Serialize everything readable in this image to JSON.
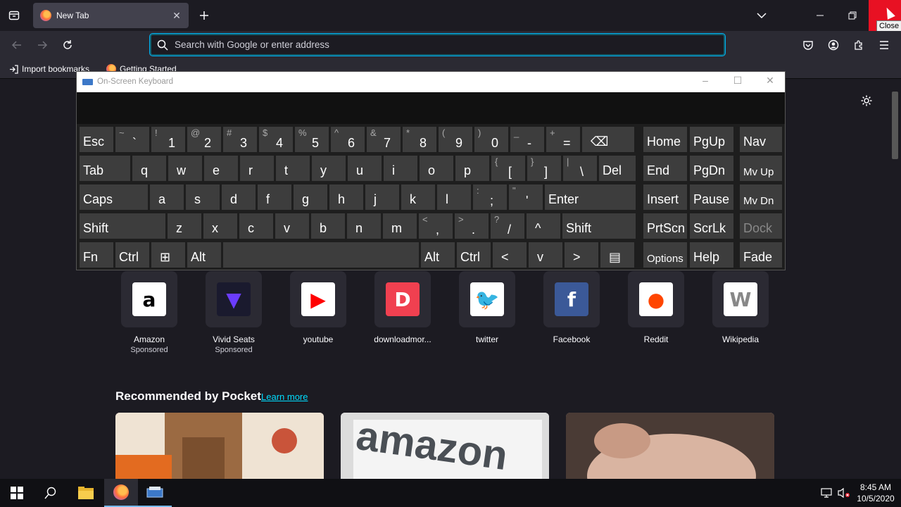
{
  "browser": {
    "tab_title": "New Tab",
    "url_placeholder": "Search with Google or enter address",
    "tooltip_close": "Close",
    "bookmarks": [
      "Import bookmarks",
      "Getting Started"
    ]
  },
  "osk": {
    "title": "On-Screen Keyboard",
    "rows": [
      [
        {
          "m": "Esc",
          "w": 48
        },
        {
          "s": "~",
          "m": "`",
          "w": 48
        },
        {
          "s": "!",
          "m": "1",
          "w": 48
        },
        {
          "s": "@",
          "m": "2",
          "w": 48
        },
        {
          "s": "#",
          "m": "3",
          "w": 48
        },
        {
          "s": "$",
          "m": "4",
          "w": 48
        },
        {
          "s": "%",
          "m": "5",
          "w": 48
        },
        {
          "s": "^",
          "m": "6",
          "w": 48
        },
        {
          "s": "&",
          "m": "7",
          "w": 48
        },
        {
          "s": "*",
          "m": "8",
          "w": 48
        },
        {
          "s": "(",
          "m": "9",
          "w": 48
        },
        {
          "s": ")",
          "m": "0",
          "w": 48
        },
        {
          "s": "_",
          "m": "-",
          "w": 48
        },
        {
          "s": "+",
          "m": "=",
          "w": 48
        },
        {
          "m": "⌫",
          "w": 74
        }
      ],
      [
        {
          "m": "Tab",
          "w": 72
        },
        {
          "m": "q",
          "w": 48
        },
        {
          "m": "w",
          "w": 48
        },
        {
          "m": "e",
          "w": 48
        },
        {
          "m": "r",
          "w": 48
        },
        {
          "m": "t",
          "w": 48
        },
        {
          "m": "y",
          "w": 48
        },
        {
          "m": "u",
          "w": 48
        },
        {
          "m": "i",
          "w": 48
        },
        {
          "m": "o",
          "w": 48
        },
        {
          "m": "p",
          "w": 48
        },
        {
          "s": "{",
          "m": "[",
          "w": 48
        },
        {
          "s": "}",
          "m": "]",
          "w": 48
        },
        {
          "s": "|",
          "m": "\\",
          "w": 48
        },
        {
          "m": "Del",
          "w": 52
        }
      ],
      [
        {
          "m": "Caps",
          "w": 97
        },
        {
          "m": "a",
          "w": 48
        },
        {
          "m": "s",
          "w": 48
        },
        {
          "m": "d",
          "w": 48
        },
        {
          "m": "f",
          "w": 48
        },
        {
          "m": "g",
          "w": 48
        },
        {
          "m": "h",
          "w": 48
        },
        {
          "m": "j",
          "w": 48
        },
        {
          "m": "k",
          "w": 48
        },
        {
          "m": "l",
          "w": 48
        },
        {
          "s": ":",
          "m": ";",
          "w": 48
        },
        {
          "s": "\"",
          "m": "'",
          "w": 48
        },
        {
          "m": "Enter",
          "w": 129
        }
      ],
      [
        {
          "m": "Shift",
          "w": 122
        },
        {
          "m": "z",
          "w": 48
        },
        {
          "m": "x",
          "w": 48
        },
        {
          "m": "c",
          "w": 48
        },
        {
          "m": "v",
          "w": 48
        },
        {
          "m": "b",
          "w": 48
        },
        {
          "m": "n",
          "w": 48
        },
        {
          "m": "m",
          "w": 48
        },
        {
          "s": "<",
          "m": ",",
          "w": 48
        },
        {
          "s": ">",
          "m": ".",
          "w": 48
        },
        {
          "s": "?",
          "m": "/",
          "w": 48
        },
        {
          "m": "^",
          "w": 48
        },
        {
          "m": "Shift",
          "w": 104
        }
      ],
      [
        {
          "m": "Fn",
          "w": 48
        },
        {
          "m": "Ctrl",
          "w": 48
        },
        {
          "m": "⊞",
          "w": 48
        },
        {
          "m": "Alt",
          "w": 48
        },
        {
          "m": "",
          "w": 278
        },
        {
          "m": "Alt",
          "w": 48
        },
        {
          "m": "Ctrl",
          "w": 48
        },
        {
          "m": "<",
          "w": 48
        },
        {
          "m": "v",
          "w": 48
        },
        {
          "m": ">",
          "w": 48
        },
        {
          "m": "▤",
          "w": 48
        }
      ]
    ],
    "nav_rows": [
      [
        "Home",
        "PgUp",
        "Nav"
      ],
      [
        "End",
        "PgDn",
        "Mv Up"
      ],
      [
        "Insert",
        "Pause",
        "Mv Dn"
      ],
      [
        "PrtScn",
        "ScrLk",
        "Dock"
      ],
      [
        "Options",
        "Help",
        "Fade"
      ]
    ]
  },
  "shortcuts": [
    {
      "name": "Amazon",
      "sponsored": "Sponsored",
      "icon": "amazon-icon",
      "bg": "#ffffff",
      "fg": "#000000",
      "glyph": "a"
    },
    {
      "name": "Vivid Seats",
      "sponsored": "Sponsored",
      "icon": "vivid-seats-icon",
      "bg": "#1a1a2e",
      "fg": "#6b3cff",
      "glyph": "▼"
    },
    {
      "name": "youtube",
      "sponsored": "",
      "icon": "youtube-icon",
      "bg": "#ffffff",
      "fg": "#ff0000",
      "glyph": "▶"
    },
    {
      "name": "downloadmor...",
      "sponsored": "",
      "icon": "downloadmore-icon",
      "bg": "#f04050",
      "fg": "#ffffff",
      "glyph": "D"
    },
    {
      "name": "twitter",
      "sponsored": "",
      "icon": "twitter-icon",
      "bg": "#ffffff",
      "fg": "#1d9bf0",
      "glyph": "🐦"
    },
    {
      "name": "Facebook",
      "sponsored": "",
      "icon": "facebook-icon",
      "bg": "#3b5998",
      "fg": "#ffffff",
      "glyph": "f"
    },
    {
      "name": "Reddit",
      "sponsored": "",
      "icon": "reddit-icon",
      "bg": "#ffffff",
      "fg": "#ff4500",
      "glyph": "●"
    },
    {
      "name": "Wikipedia",
      "sponsored": "",
      "icon": "wikipedia-icon",
      "bg": "#ffffff",
      "fg": "#888888",
      "glyph": "W"
    }
  ],
  "pocket": {
    "title": "Recommended by Pocket",
    "learn_more": "Learn more"
  },
  "taskbar": {
    "time": "8:45 AM",
    "date": "10/5/2020"
  }
}
